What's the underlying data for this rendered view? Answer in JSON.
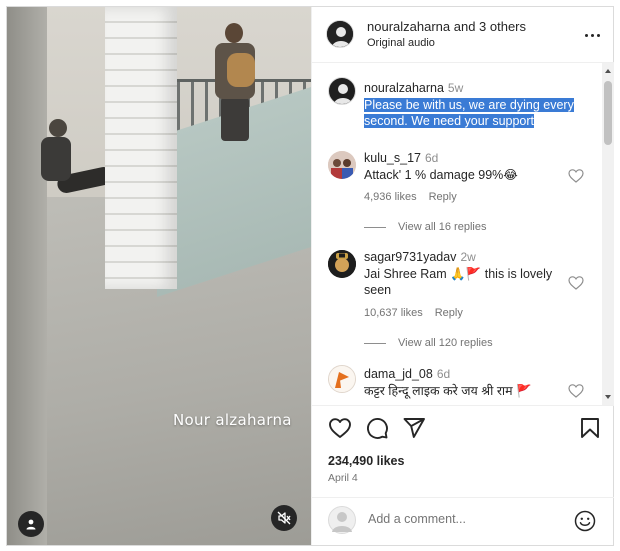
{
  "post": {
    "video": {
      "watermark": "Nour alzaharna",
      "tag_icon": "user-tag-icon",
      "mute_icon": "speaker-muted-icon"
    },
    "header": {
      "username": "nouralzaharna",
      "collab_text": " and 3 others",
      "audio": "Original audio",
      "more_icon": "more-horizontal-icon"
    },
    "comments": [
      {
        "username": "nouralzaharna",
        "time": "5w",
        "text_lines": [
          "Please be with us, we are dying every",
          "second. We need your support"
        ],
        "highlighted": true
      },
      {
        "username": "kulu_s_17",
        "time": "6d",
        "text": "Attack' 1 % damage 99%😂",
        "likes": "4,936 likes",
        "reply": "Reply",
        "view_replies": "View all 16 replies"
      },
      {
        "username": "sagar9731yadav",
        "time": "2w",
        "text_lines": [
          "Jai Shree Ram 🙏🚩 this is lovely",
          "seen"
        ],
        "likes": "10,637 likes",
        "reply": "Reply",
        "view_replies": "View all 120 replies"
      },
      {
        "username": "dama_jd_08",
        "time": "6d",
        "text": "कट्टर हिन्दू लाइक करे जय श्री राम 🚩"
      }
    ],
    "actions": {
      "like_icon": "heart-icon",
      "comment_icon": "comment-icon",
      "share_icon": "share-icon",
      "save_icon": "bookmark-icon"
    },
    "likes": "234,490 likes",
    "date": "April 4",
    "add_comment": {
      "placeholder": "Add a comment...",
      "emoji_icon": "emoji-icon"
    }
  },
  "colors": {
    "highlight": "#3a7bd5",
    "text": "#262626",
    "muted": "#737373",
    "border": "#efefef"
  }
}
